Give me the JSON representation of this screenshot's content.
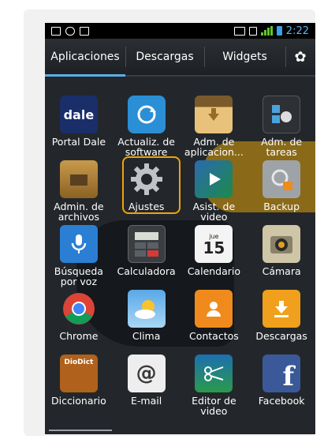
{
  "status_bar": {
    "time": "2:22"
  },
  "tabs": [
    {
      "label": "Aplicaciones",
      "active": true
    },
    {
      "label": "Descargas",
      "active": false
    },
    {
      "label": "Widgets",
      "active": false
    }
  ],
  "apps": [
    {
      "label": "Portal Dale",
      "icon": "dale-icon",
      "icon_text": "dale"
    },
    {
      "label": "Actualiz. de\nsoftware",
      "icon": "update-icon"
    },
    {
      "label": "Adm. de\naplicacion...",
      "icon": "app-manager-icon"
    },
    {
      "label": "Adm. de\ntareas",
      "icon": "task-manager-icon"
    },
    {
      "label": "Admin. de\narchivos",
      "icon": "folder-icon"
    },
    {
      "label": "Ajustes",
      "icon": "settings-gear-icon"
    },
    {
      "label": "Asist. de\nvideo",
      "icon": "video-wizard-icon"
    },
    {
      "label": "Backup",
      "icon": "backup-icon"
    },
    {
      "label": "Búsqueda\npor voz",
      "icon": "microphone-icon"
    },
    {
      "label": "Calculadora",
      "icon": "calculator-icon"
    },
    {
      "label": "Calendario",
      "icon": "calendar-icon",
      "icon_text": "15",
      "icon_subtext": "jue"
    },
    {
      "label": "Cámara",
      "icon": "camera-icon"
    },
    {
      "label": "Chrome",
      "icon": "chrome-icon"
    },
    {
      "label": "Clima",
      "icon": "weather-icon"
    },
    {
      "label": "Contactos",
      "icon": "contacts-icon"
    },
    {
      "label": "Descargas",
      "icon": "download-icon"
    },
    {
      "label": "Diccionario",
      "icon": "dictionary-icon",
      "icon_text": "DioDict"
    },
    {
      "label": "E-mail",
      "icon": "email-icon",
      "icon_text": "@"
    },
    {
      "label": "Editor de\nvideo",
      "icon": "video-editor-icon"
    },
    {
      "label": "Facebook",
      "icon": "facebook-icon",
      "icon_text": "f"
    }
  ],
  "highlighted_app": "Ajustes",
  "colors": {
    "accent": "#5aaee8",
    "highlight": "#f2a20b",
    "time": "#59b6f5"
  }
}
